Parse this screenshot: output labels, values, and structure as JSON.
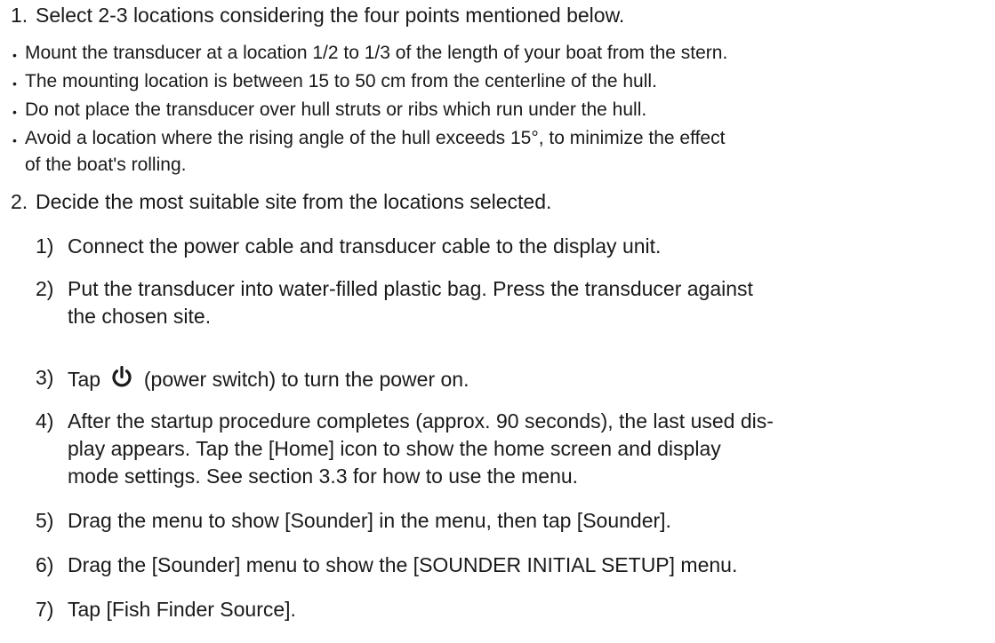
{
  "steps": [
    {
      "number": "1.",
      "text": "Select 2-3 locations considering the four points mentioned below.",
      "bullets": [
        "Mount the transducer at a location 1/2 to 1/3 of the length of your boat from the stern.",
        "The mounting location is between 15 to 50 cm from the centerline of the hull.",
        "Do not place the transducer over hull struts or ribs which run under the hull.",
        "Avoid a location where the rising angle of the hull exceeds 15°, to minimize the effect",
        "of the boat's rolling."
      ]
    },
    {
      "number": "2.",
      "text": "Decide the most suitable site from the locations selected.",
      "substeps": [
        {
          "number": "1)",
          "lines": [
            "Connect the power cable and transducer cable to the display unit."
          ]
        },
        {
          "number": "2)",
          "lines": [
            "Put the transducer into water-filled plastic bag. Press the transducer against",
            "the chosen site."
          ]
        },
        {
          "number": "3)",
          "before": "Tap",
          "after": "(power switch) to turn the power on.",
          "icon": "power-icon"
        },
        {
          "number": "4)",
          "lines": [
            "After the startup procedure completes (approx. 90 seconds), the last used dis-",
            "play appears. Tap the [Home] icon to show the home screen and display",
            "mode settings. See section 3.3 for how to use the menu."
          ]
        },
        {
          "number": "5)",
          "lines": [
            "Drag the menu to show [Sounder] in the menu, then tap [Sounder]."
          ]
        },
        {
          "number": "6)",
          "lines": [
            "Drag the [Sounder] menu to show the [SOUNDER INITIAL SETUP] menu."
          ]
        },
        {
          "number": "7)",
          "lines": [
            "Tap [Fish Finder Source]."
          ]
        }
      ]
    }
  ]
}
